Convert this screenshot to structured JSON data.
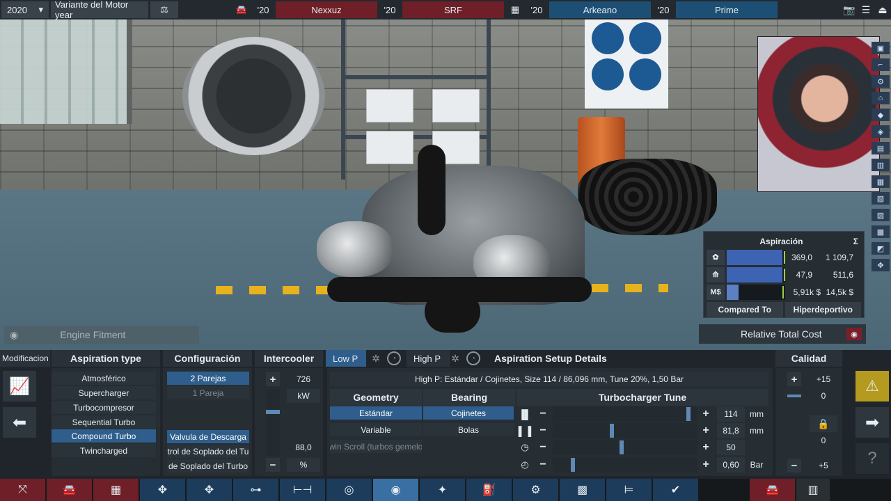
{
  "topbar": {
    "year": "2020",
    "variant": "Variante del Motor year",
    "comparisons": [
      {
        "year": "'20",
        "name": "Nexxuz"
      },
      {
        "year": "'20",
        "name": "SRF"
      },
      {
        "year": "'20",
        "name": "Arkeano"
      },
      {
        "year": "'20",
        "name": "Prime"
      }
    ]
  },
  "stats_panel": {
    "title": "Aspiración",
    "sigma": "Σ",
    "rows": [
      {
        "icon": "engine-power-icon",
        "value": "369,0",
        "total": "1 109,7",
        "fill": 0.95
      },
      {
        "icon": "torque-icon",
        "value": "47,9",
        "total": "511,6",
        "fill": 0.95
      },
      {
        "icon_label": "M$",
        "value": "5,91k $",
        "total": "14,5k $",
        "fill": 0.2
      }
    ],
    "compared_to_label": "Compared To",
    "compared_to_value": "Hiperdeportivo"
  },
  "relative_total_cost": "Relative Total Cost",
  "engine_fitment": "Engine Fitment",
  "panel": {
    "left_tab": "Modificacion de las",
    "aspiration_type": {
      "title": "Aspiration type",
      "options": [
        "Atmosférico",
        "Supercharger",
        "Turbocompresor",
        "Sequential Turbo",
        "Compound Turbo",
        "Twincharged"
      ],
      "selected": "Compound Turbo"
    },
    "configuracion": {
      "title": "Configuración",
      "options": [
        "2 Parejas",
        "1 Pareja"
      ],
      "valves": [
        "Valvula de Descarga",
        "trol de Soplado del Tu",
        "de Soplado del Turbo"
      ]
    },
    "intercooler": {
      "title": "Intercooler",
      "power": "726",
      "power_unit": "kW",
      "percent": "88,0",
      "percent_unit": "%"
    },
    "setup": {
      "tab_low": "Low P",
      "tab_high": "High P",
      "title": "Aspiration Setup Details",
      "summary": "High P: Estándar / Cojinetes, Size 114 / 86,096 mm, Tune 20%, 1,50 Bar",
      "geometry_title": "Geometry",
      "geometry_options": [
        "Estándar",
        "Variable",
        "win Scroll (turbos gemelo"
      ],
      "bearing_title": "Bearing",
      "bearing_options": [
        "Cojinetes",
        "Bolas"
      ],
      "tune_title": "Turbocharger Tune",
      "tune_rows": [
        {
          "icon": "compressor-size-icon",
          "value": "114",
          "unit": "mm",
          "level": 0.93
        },
        {
          "icon": "turbine-size-icon",
          "value": "81,8",
          "unit": "mm",
          "level": 0.4
        },
        {
          "icon": "tune-dial-icon",
          "value": "50",
          "unit": "",
          "level": 0.47
        },
        {
          "icon": "boost-gauge-icon",
          "value": "0,60",
          "unit": "Bar",
          "level": 0.14
        }
      ]
    },
    "calidad": {
      "title": "Calidad",
      "top": "+15",
      "top_value": "0",
      "bottom_value": "0",
      "bottom": "+5"
    }
  }
}
